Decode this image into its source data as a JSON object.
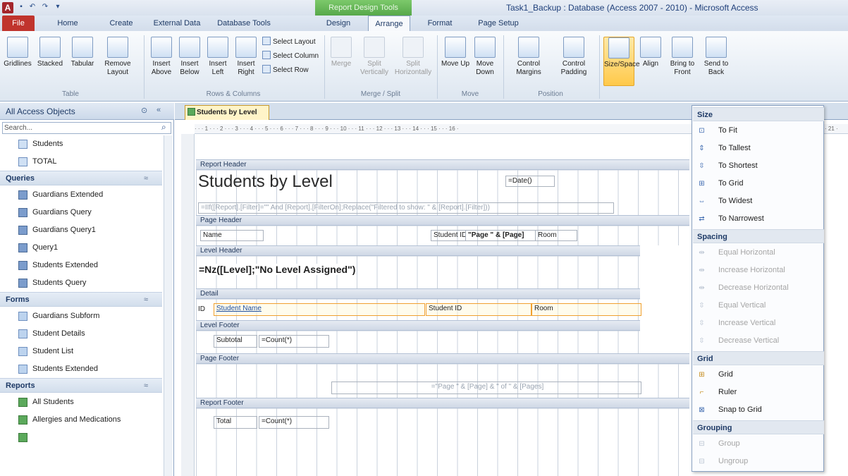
{
  "app_letter": "A",
  "context_tab": "Report Design Tools",
  "window_title": "Task1_Backup : Database (Access 2007 - 2010)  -  Microsoft Access",
  "tabs": [
    "File",
    "Home",
    "Create",
    "External Data",
    "Database Tools",
    "Design",
    "Arrange",
    "Format",
    "Page Setup"
  ],
  "ribbon": {
    "table": {
      "gridlines": "Gridlines",
      "stacked": "Stacked",
      "tabular": "Tabular",
      "remove_layout": "Remove Layout",
      "group": "Table"
    },
    "rows": {
      "insert_above": "Insert Above",
      "insert_below": "Insert Below",
      "insert_left": "Insert Left",
      "insert_right": "Insert Right",
      "select_layout": "Select Layout",
      "select_column": "Select Column",
      "select_row": "Select Row",
      "group": "Rows & Columns"
    },
    "merge": {
      "merge": "Merge",
      "split_v": "Split Vertically",
      "split_h": "Split Horizontally",
      "group": "Merge / Split"
    },
    "move": {
      "up": "Move Up",
      "down": "Move Down",
      "group": "Move"
    },
    "position": {
      "margins": "Control Margins",
      "padding": "Control Padding",
      "group": "Position"
    },
    "sizing": {
      "size_space": "Size/Space",
      "align": "Align",
      "front": "Bring to Front",
      "back": "Send to Back"
    }
  },
  "nav": {
    "title": "All Access Objects",
    "search_placeholder": "Search...",
    "tables": [
      "Students",
      "TOTAL"
    ],
    "queries_label": "Queries",
    "queries": [
      "Guardians Extended",
      "Guardians Query",
      "Guardians Query1",
      "Query1",
      "Students Extended",
      "Students Query"
    ],
    "forms_label": "Forms",
    "forms": [
      "Guardians Subform",
      "Student Details",
      "Student List",
      "Students Extended"
    ],
    "reports_label": "Reports",
    "reports": [
      "All Students",
      "Allergies and Medications"
    ]
  },
  "doc_tab": "Students by Level",
  "ruler": "· · · 1 · · · 2 · · · 3 · · · 4 · · · 5 · · · 6 · · · 7 · · · 8 · · · 9 · · · 10 · · · 11 · · · 12 · · · 13 · · · 14 · · · 15 · · · 16 ·",
  "ruler_right": "· 21 ·",
  "report": {
    "sections": {
      "report_header": "Report Header",
      "page_header": "Page Header",
      "level_header": "Level Header",
      "detail": "Detail",
      "level_footer": "Level Footer",
      "page_footer": "Page Footer",
      "report_footer": "Report Footer"
    },
    "title": "Students by Level",
    "date_ctrl": "=Date()",
    "filter_ctrl": "=IIf([Report].[Filter]=\"\" And [Report].[FilterOn];Replace(\"Filtered to show: \" & [Report].[Filter]))",
    "ph_name": "Name",
    "ph_student": "Student ID",
    "ph_page": "\"Page \" & [Page]",
    "ph_room": "Room",
    "level_expr": "=Nz([Level];\"No Level Assigned\")",
    "d_id": "ID",
    "d_name": "Student Name",
    "d_student": "Student ID",
    "d_room": "Room",
    "lf_subtotal": "Subtotal",
    "lf_count": "=Count(*)",
    "pf_page": "=\"Page \" & [Page] & \" of \" & [Pages]",
    "rf_total": "Total",
    "rf_count": "=Count(*)"
  },
  "menu": {
    "size_label": "Size",
    "size_items": [
      "To Fit",
      "To Tallest",
      "To Shortest",
      "To Grid",
      "To Widest",
      "To Narrowest"
    ],
    "spacing_label": "Spacing",
    "spacing_items": [
      "Equal Horizontal",
      "Increase Horizontal",
      "Decrease Horizontal",
      "Equal Vertical",
      "Increase Vertical",
      "Decrease Vertical"
    ],
    "grid_label": "Grid",
    "grid_items": [
      "Grid",
      "Ruler",
      "Snap to Grid"
    ],
    "grouping_label": "Grouping",
    "grouping_items": [
      "Group",
      "Ungroup"
    ]
  }
}
